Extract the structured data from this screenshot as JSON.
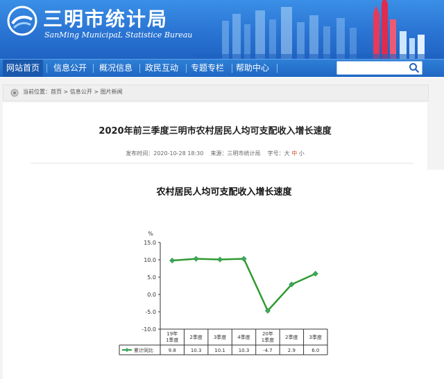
{
  "site": {
    "title": "三明市统计局",
    "subtitle": "SanMing MunicipaL Statistice Bureau"
  },
  "nav": {
    "items": [
      "网站首页",
      "信息公开",
      "概况信息",
      "政民互动",
      "专题专栏",
      "帮助中心"
    ],
    "active": 0
  },
  "search": {
    "placeholder": ""
  },
  "breadcrumb": {
    "prefix": "当前位置：",
    "items": [
      "首页",
      "信息公开",
      "图片新闻"
    ],
    "sep": " > "
  },
  "article": {
    "title": "2020年前三季度三明市农村居民人均可支配收入增长速度",
    "publish_label": "发布时间：",
    "publish_time": "2020-10-28 18:30",
    "source_label": "来源：",
    "source": "三明市统计局",
    "fontsize_label": "字号：",
    "fontsizes": [
      "大",
      "中",
      "小"
    ],
    "selected_fontsize": 1
  },
  "colors": {
    "header_blue": "#2a74d3",
    "line": "#2f9a2f",
    "marker": "#3aa76d",
    "highlight": "#d54b1f"
  },
  "chart_data": {
    "type": "line",
    "title": "农村居民人均可支配收入增长速度",
    "ylabel": "%",
    "ylim": [
      -10,
      15
    ],
    "yticks": [
      "15.0",
      "10.0",
      "5.0",
      "0.0",
      "-5.0",
      "-10.0"
    ],
    "categories": [
      "19年1季度",
      "2季度",
      "3季度",
      "4季度",
      "20年1季度",
      "2季度",
      "3季度"
    ],
    "series": [
      {
        "name": "累计同比",
        "values": [
          9.8,
          10.3,
          10.1,
          10.3,
          -4.7,
          2.9,
          6.0
        ]
      }
    ],
    "value_labels": [
      "9.8",
      "10.3",
      "10.1",
      "10.3",
      "-4.7",
      "2.9",
      "6.0"
    ]
  }
}
